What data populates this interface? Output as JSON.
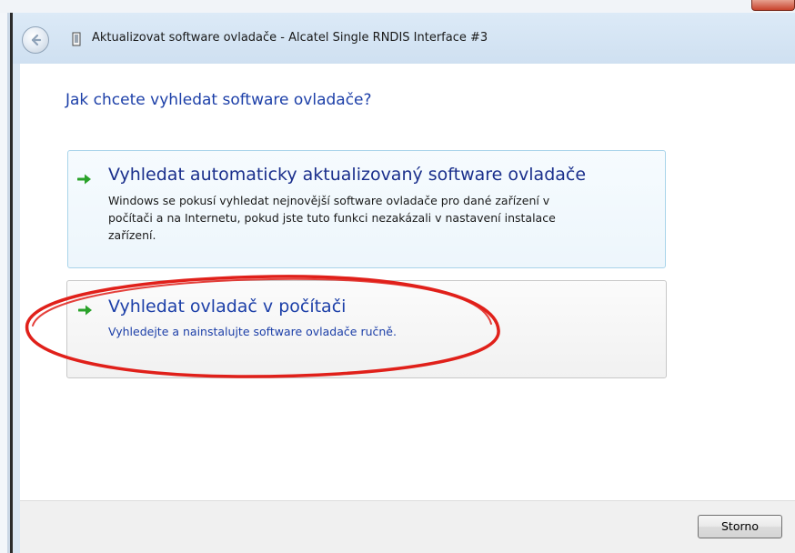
{
  "window": {
    "title": "Aktualizovat software ovladače - Alcatel Single RNDIS Interface #3"
  },
  "wizard": {
    "heading": "Jak chcete vyhledat software ovladače?",
    "options": [
      {
        "title": "Vyhledat automaticky aktualizovaný software ovladače",
        "description_lines": [
          "Windows se pokusí vyhledat nejnovější software ovladače pro dané zařízení v",
          "počítači a na Internetu, pokud jste tuto funkci nezakázali v nastavení instalace",
          "zařízení."
        ]
      },
      {
        "title": "Vyhledat ovladač v počítači",
        "description_lines": [
          "Vyhledejte a nainstalujte software ovladače ručně."
        ]
      }
    ]
  },
  "footer": {
    "cancel_label": "Storno"
  },
  "colors": {
    "heading": "#1c3fa8",
    "arrow": "#2aa22a",
    "annotation": "#e0201a"
  },
  "icons": {
    "back": "back-arrow-icon",
    "device": "network-device-icon",
    "option_arrow": "green-arrow-icon"
  }
}
